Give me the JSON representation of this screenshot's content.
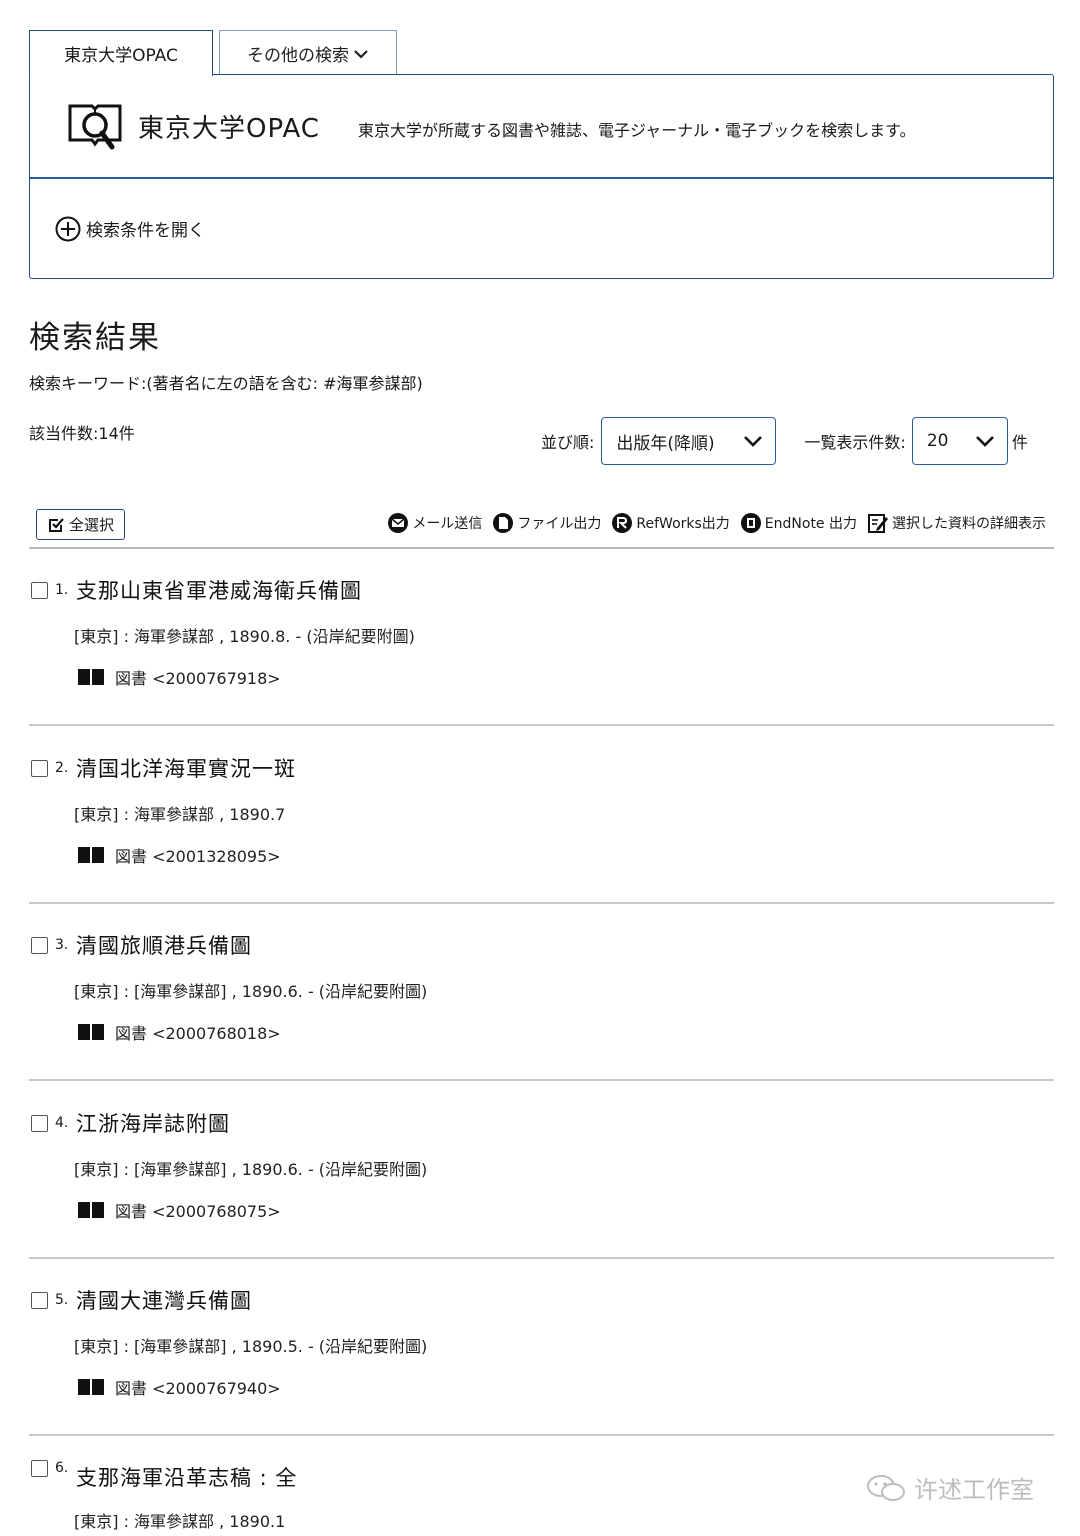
{
  "tabs": {
    "opac": "東京大学OPAC",
    "other": "その他の検索"
  },
  "panel": {
    "title": "東京大学OPAC",
    "description": "東京大学が所蔵する図書や雑誌、電子ジャーナル・電子ブックを検索します。",
    "open_conditions": "検索条件を開く"
  },
  "results": {
    "heading": "検索結果",
    "keyword": "検索キーワード:(著者名に左の語を含む: #海軍参謀部)",
    "count": "該当件数:14件",
    "sort_label": "並び順:",
    "sort_value": "出版年(降順)",
    "per_page_label": "一覧表示件数:",
    "per_page_value": "20",
    "per_page_unit": "件"
  },
  "toolbar": {
    "select_all": "全選択",
    "mail": "メール送信",
    "file": "ファイル出力",
    "refworks": "RefWorks出力",
    "endnote": "EndNote 出力",
    "detail": "選択した資料の詳細表示"
  },
  "items": [
    {
      "num": "1.",
      "title": "支那山東省軍港威海衛兵備圖",
      "pub": "[東京] : 海軍參謀部 , 1890.8. - (沿岸紀要附圖)",
      "type": "図書 <2000767918>"
    },
    {
      "num": "2.",
      "title": "清国北洋海軍實況一斑",
      "pub": "[東京] : 海軍參謀部 , 1890.7",
      "type": "図書 <2001328095>"
    },
    {
      "num": "3.",
      "title": "清國旅順港兵備圖",
      "pub": "[東京] : [海軍參謀部] , 1890.6. - (沿岸紀要附圖)",
      "type": "図書 <2000768018>"
    },
    {
      "num": "4.",
      "title": "江浙海岸誌附圖",
      "pub": "[東京] : [海軍參謀部] , 1890.6. - (沿岸紀要附圖)",
      "type": "図書 <2000768075>"
    },
    {
      "num": "5.",
      "title": "清國大連灣兵備圖",
      "pub": "[東京] : [海軍參謀部] , 1890.5. - (沿岸紀要附圖)",
      "type": "図書 <2000767940>"
    },
    {
      "num": "6.",
      "title": "支那海軍沿革志稿 : 全",
      "pub": "[東京] : 海軍參謀部 , 1890.1"
    }
  ],
  "watermark": "许述工作室"
}
